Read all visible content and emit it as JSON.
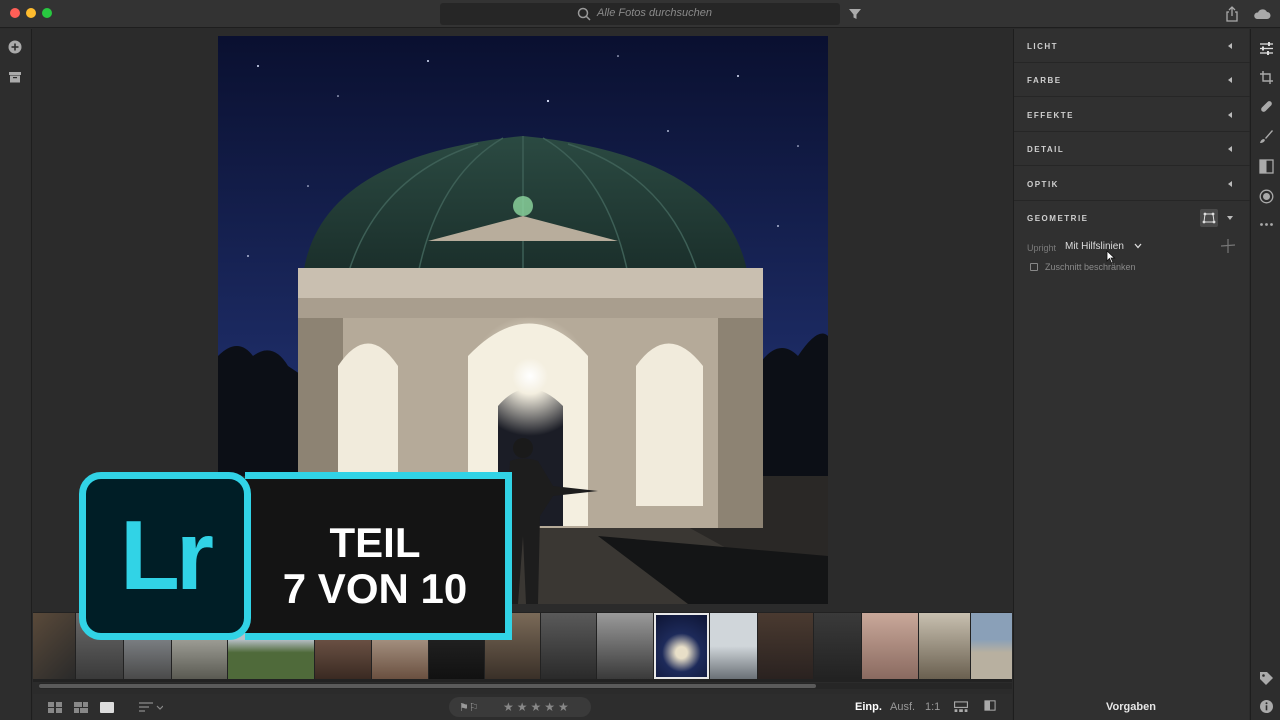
{
  "titlebar": {
    "search_placeholder": "Alle Fotos durchsuchen",
    "icons": [
      "search-icon",
      "filter-icon",
      "share-icon",
      "cloud-icon"
    ]
  },
  "left_rail": {
    "icons": [
      "add-photos-icon",
      "library-icon"
    ]
  },
  "right_panel": {
    "sections": [
      {
        "label": "LICHT",
        "state": "collapsed"
      },
      {
        "label": "FARBE",
        "state": "collapsed"
      },
      {
        "label": "EFFEKTE",
        "state": "collapsed"
      },
      {
        "label": "DETAIL",
        "state": "collapsed"
      },
      {
        "label": "OPTIK",
        "state": "collapsed"
      },
      {
        "label": "GEOMETRIE",
        "state": "expanded"
      }
    ],
    "geometry": {
      "upright_label": "Upright",
      "upright_value": "Mit Hilfslinien",
      "constrain_crop_label": "Zuschnitt beschränken",
      "constrain_crop_checked": false
    },
    "presets_label": "Vorgaben"
  },
  "tool_rail": {
    "icons": [
      "edit-sliders-icon",
      "crop-icon",
      "healing-icon",
      "brush-icon",
      "linear-gradient-icon",
      "radial-gradient-icon",
      "more-icon",
      "tag-icon",
      "info-icon"
    ]
  },
  "bottom_bar": {
    "zoom_options": [
      "Einp.",
      "Ausf.",
      "1:1"
    ],
    "active_zoom": "Einp.",
    "rating_stars": "★★★★★",
    "flags": "⚑⚐"
  },
  "filmstrip": {
    "selected_index": 11,
    "thumbnail_count": 19
  },
  "overlay": {
    "logo_text": "Lr",
    "line1": "TEIL",
    "line2": "7 VON 10"
  },
  "colors": {
    "accent": "#31d3e6",
    "panel_bg": "#303030",
    "canvas_bg": "#2b2b2b"
  }
}
